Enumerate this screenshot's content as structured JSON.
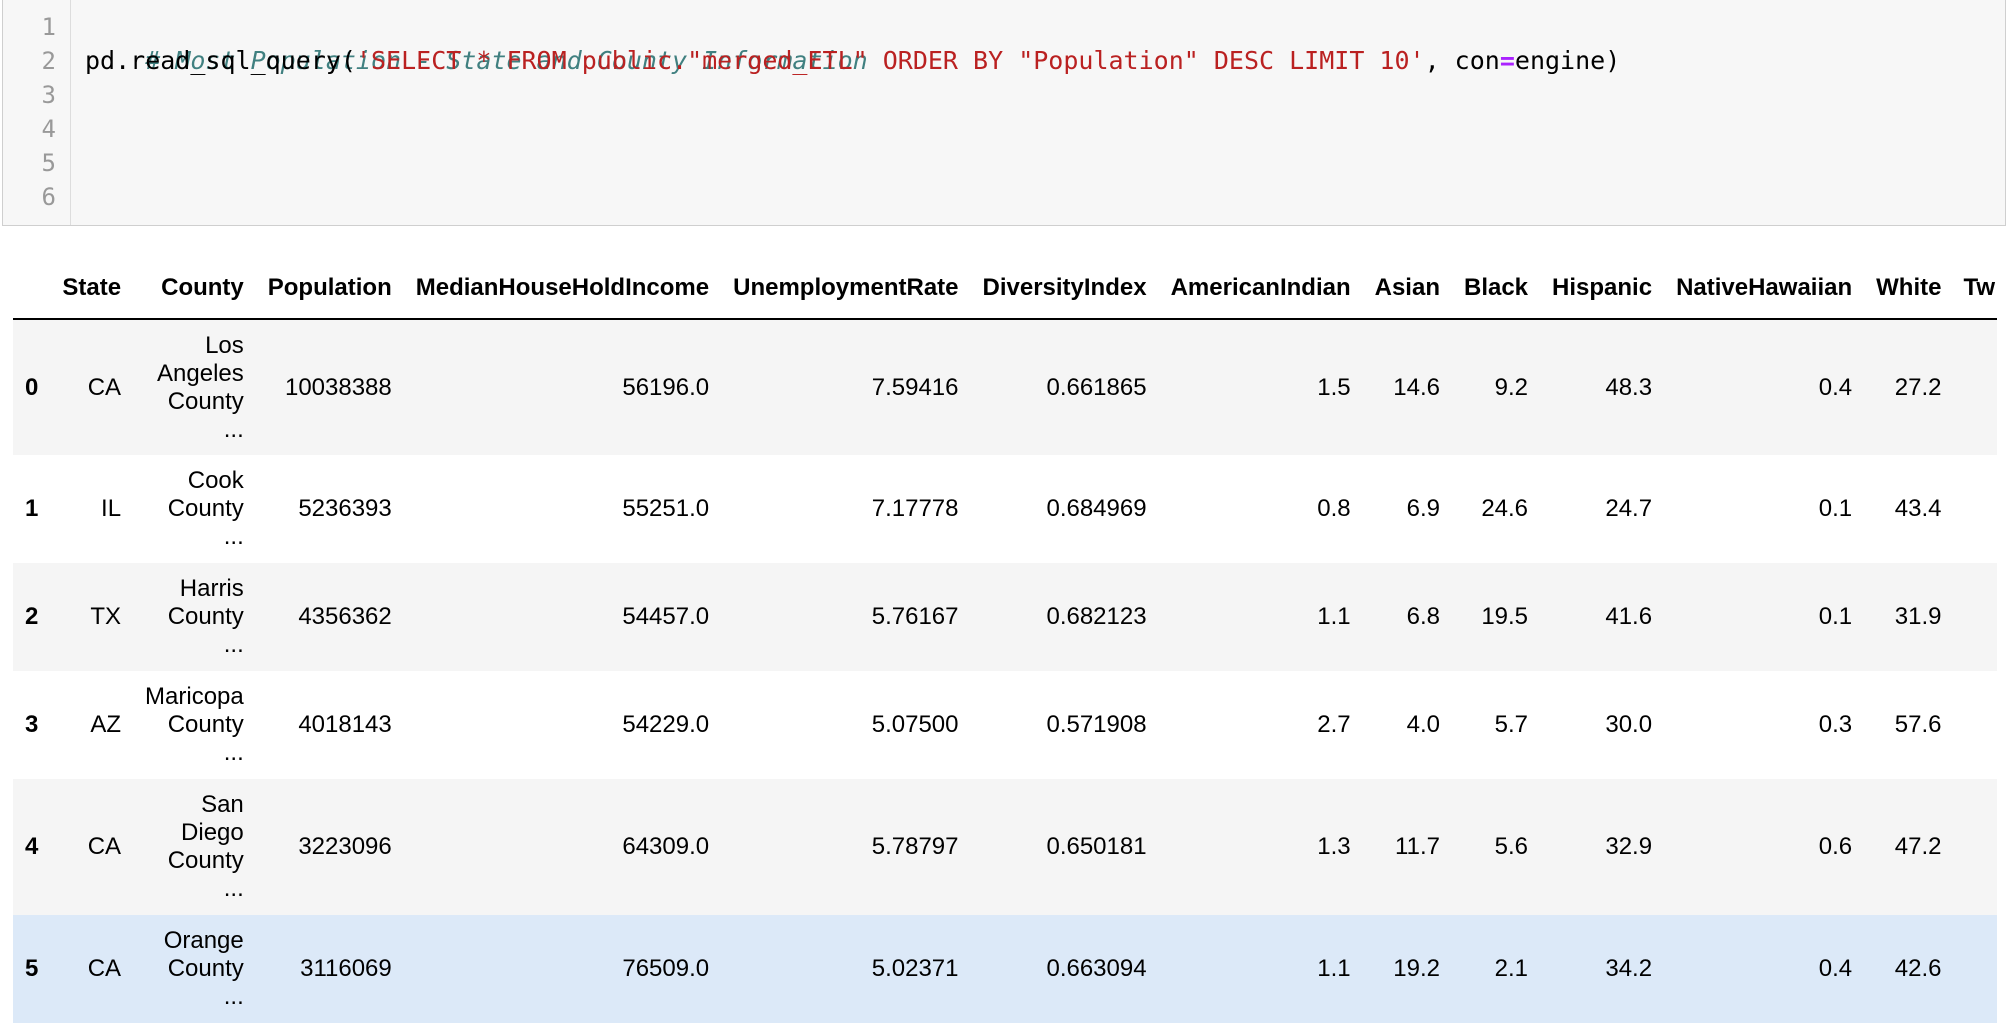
{
  "code_cell": {
    "line_numbers": [
      "1",
      "2",
      "3",
      "4",
      "5",
      "6"
    ],
    "comment": "# Most Population - State and County Information",
    "call_prefix": "pd.read_sql_query(",
    "query_string": "'SELECT * FROM public.\"merged_ETL\" ORDER BY \"Population\" DESC LIMIT 10'",
    "arg_sep": ", con",
    "assign_op": "=",
    "arg_value": "engine)"
  },
  "dataframe": {
    "columns": [
      "State",
      "County",
      "Population",
      "MedianHouseHoldIncome",
      "UnemploymentRate",
      "DiversityIndex",
      "AmericanIndian",
      "Asian",
      "Black",
      "Hispanic",
      "NativeHawaiian",
      "White",
      "Tw"
    ],
    "rows": [
      {
        "index": "0",
        "state": "CA",
        "county": [
          "Los",
          "Angeles",
          "County",
          "..."
        ],
        "population": "10038388",
        "median_income": "56196.0",
        "unemployment": "7.59416",
        "diversity": "0.661865",
        "american_indian": "1.5",
        "asian": "14.6",
        "black": "9.2",
        "hispanic": "48.3",
        "native_hawaiian": "0.4",
        "white": "27.2",
        "style": "odd"
      },
      {
        "index": "1",
        "state": "IL",
        "county": [
          "Cook",
          "County",
          "..."
        ],
        "population": "5236393",
        "median_income": "55251.0",
        "unemployment": "7.17778",
        "diversity": "0.684969",
        "american_indian": "0.8",
        "asian": "6.9",
        "black": "24.6",
        "hispanic": "24.7",
        "native_hawaiian": "0.1",
        "white": "43.4",
        "style": "even"
      },
      {
        "index": "2",
        "state": "TX",
        "county": [
          "Harris",
          "County",
          "..."
        ],
        "population": "4356362",
        "median_income": "54457.0",
        "unemployment": "5.76167",
        "diversity": "0.682123",
        "american_indian": "1.1",
        "asian": "6.8",
        "black": "19.5",
        "hispanic": "41.6",
        "native_hawaiian": "0.1",
        "white": "31.9",
        "style": "odd"
      },
      {
        "index": "3",
        "state": "AZ",
        "county": [
          "Maricopa",
          "County",
          "..."
        ],
        "population": "4018143",
        "median_income": "54229.0",
        "unemployment": "5.07500",
        "diversity": "0.571908",
        "american_indian": "2.7",
        "asian": "4.0",
        "black": "5.7",
        "hispanic": "30.0",
        "native_hawaiian": "0.3",
        "white": "57.6",
        "style": "even"
      },
      {
        "index": "4",
        "state": "CA",
        "county": [
          "San",
          "Diego",
          "County",
          "..."
        ],
        "population": "3223096",
        "median_income": "64309.0",
        "unemployment": "5.78797",
        "diversity": "0.650181",
        "american_indian": "1.3",
        "asian": "11.7",
        "black": "5.6",
        "hispanic": "32.9",
        "native_hawaiian": "0.6",
        "white": "47.2",
        "style": "odd"
      },
      {
        "index": "5",
        "state": "CA",
        "county": [
          "Orange",
          "County",
          "..."
        ],
        "population": "3116069",
        "median_income": "76509.0",
        "unemployment": "5.02371",
        "diversity": "0.663094",
        "american_indian": "1.1",
        "asian": "19.2",
        "black": "2.1",
        "hispanic": "34.2",
        "native_hawaiian": "0.4",
        "white": "42.6",
        "style": "hover"
      }
    ]
  },
  "colors": {
    "code_background": "#f7f7f7",
    "comment": "#408080",
    "string": "#ba2121",
    "operator": "#aa22ff",
    "row_stripe": "#f5f5f5",
    "row_hover": "#dce9f8"
  }
}
